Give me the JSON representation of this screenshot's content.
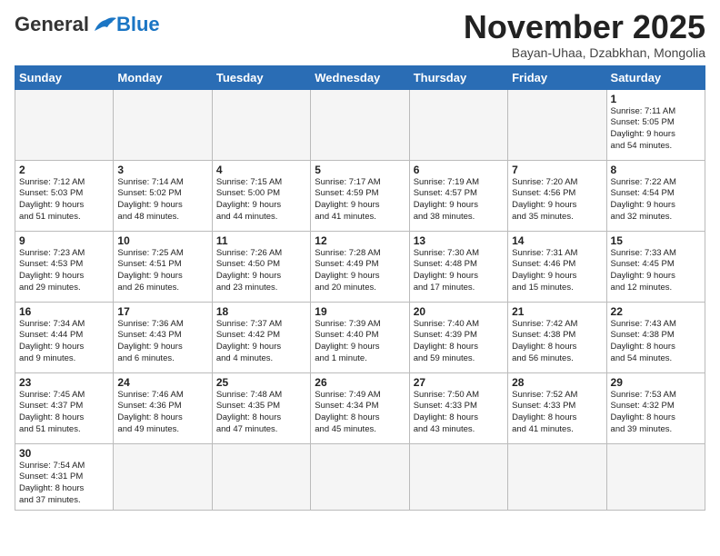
{
  "logo": {
    "general": "General",
    "blue": "Blue"
  },
  "title": "November 2025",
  "subtitle": "Bayan-Uhaa, Dzabkhan, Mongolia",
  "days_header": [
    "Sunday",
    "Monday",
    "Tuesday",
    "Wednesday",
    "Thursday",
    "Friday",
    "Saturday"
  ],
  "weeks": [
    [
      {
        "day": "",
        "info": "",
        "empty": true
      },
      {
        "day": "",
        "info": "",
        "empty": true
      },
      {
        "day": "",
        "info": "",
        "empty": true
      },
      {
        "day": "",
        "info": "",
        "empty": true
      },
      {
        "day": "",
        "info": "",
        "empty": true
      },
      {
        "day": "",
        "info": "",
        "empty": true
      },
      {
        "day": "1",
        "info": "Sunrise: 7:11 AM\nSunset: 5:05 PM\nDaylight: 9 hours\nand 54 minutes."
      }
    ],
    [
      {
        "day": "2",
        "info": "Sunrise: 7:12 AM\nSunset: 5:03 PM\nDaylight: 9 hours\nand 51 minutes."
      },
      {
        "day": "3",
        "info": "Sunrise: 7:14 AM\nSunset: 5:02 PM\nDaylight: 9 hours\nand 48 minutes."
      },
      {
        "day": "4",
        "info": "Sunrise: 7:15 AM\nSunset: 5:00 PM\nDaylight: 9 hours\nand 44 minutes."
      },
      {
        "day": "5",
        "info": "Sunrise: 7:17 AM\nSunset: 4:59 PM\nDaylight: 9 hours\nand 41 minutes."
      },
      {
        "day": "6",
        "info": "Sunrise: 7:19 AM\nSunset: 4:57 PM\nDaylight: 9 hours\nand 38 minutes."
      },
      {
        "day": "7",
        "info": "Sunrise: 7:20 AM\nSunset: 4:56 PM\nDaylight: 9 hours\nand 35 minutes."
      },
      {
        "day": "8",
        "info": "Sunrise: 7:22 AM\nSunset: 4:54 PM\nDaylight: 9 hours\nand 32 minutes."
      }
    ],
    [
      {
        "day": "9",
        "info": "Sunrise: 7:23 AM\nSunset: 4:53 PM\nDaylight: 9 hours\nand 29 minutes."
      },
      {
        "day": "10",
        "info": "Sunrise: 7:25 AM\nSunset: 4:51 PM\nDaylight: 9 hours\nand 26 minutes."
      },
      {
        "day": "11",
        "info": "Sunrise: 7:26 AM\nSunset: 4:50 PM\nDaylight: 9 hours\nand 23 minutes."
      },
      {
        "day": "12",
        "info": "Sunrise: 7:28 AM\nSunset: 4:49 PM\nDaylight: 9 hours\nand 20 minutes."
      },
      {
        "day": "13",
        "info": "Sunrise: 7:30 AM\nSunset: 4:48 PM\nDaylight: 9 hours\nand 17 minutes."
      },
      {
        "day": "14",
        "info": "Sunrise: 7:31 AM\nSunset: 4:46 PM\nDaylight: 9 hours\nand 15 minutes."
      },
      {
        "day": "15",
        "info": "Sunrise: 7:33 AM\nSunset: 4:45 PM\nDaylight: 9 hours\nand 12 minutes."
      }
    ],
    [
      {
        "day": "16",
        "info": "Sunrise: 7:34 AM\nSunset: 4:44 PM\nDaylight: 9 hours\nand 9 minutes."
      },
      {
        "day": "17",
        "info": "Sunrise: 7:36 AM\nSunset: 4:43 PM\nDaylight: 9 hours\nand 6 minutes."
      },
      {
        "day": "18",
        "info": "Sunrise: 7:37 AM\nSunset: 4:42 PM\nDaylight: 9 hours\nand 4 minutes."
      },
      {
        "day": "19",
        "info": "Sunrise: 7:39 AM\nSunset: 4:40 PM\nDaylight: 9 hours\nand 1 minute."
      },
      {
        "day": "20",
        "info": "Sunrise: 7:40 AM\nSunset: 4:39 PM\nDaylight: 8 hours\nand 59 minutes."
      },
      {
        "day": "21",
        "info": "Sunrise: 7:42 AM\nSunset: 4:38 PM\nDaylight: 8 hours\nand 56 minutes."
      },
      {
        "day": "22",
        "info": "Sunrise: 7:43 AM\nSunset: 4:38 PM\nDaylight: 8 hours\nand 54 minutes."
      }
    ],
    [
      {
        "day": "23",
        "info": "Sunrise: 7:45 AM\nSunset: 4:37 PM\nDaylight: 8 hours\nand 51 minutes."
      },
      {
        "day": "24",
        "info": "Sunrise: 7:46 AM\nSunset: 4:36 PM\nDaylight: 8 hours\nand 49 minutes."
      },
      {
        "day": "25",
        "info": "Sunrise: 7:48 AM\nSunset: 4:35 PM\nDaylight: 8 hours\nand 47 minutes."
      },
      {
        "day": "26",
        "info": "Sunrise: 7:49 AM\nSunset: 4:34 PM\nDaylight: 8 hours\nand 45 minutes."
      },
      {
        "day": "27",
        "info": "Sunrise: 7:50 AM\nSunset: 4:33 PM\nDaylight: 8 hours\nand 43 minutes."
      },
      {
        "day": "28",
        "info": "Sunrise: 7:52 AM\nSunset: 4:33 PM\nDaylight: 8 hours\nand 41 minutes."
      },
      {
        "day": "29",
        "info": "Sunrise: 7:53 AM\nSunset: 4:32 PM\nDaylight: 8 hours\nand 39 minutes."
      }
    ],
    [
      {
        "day": "30",
        "info": "Sunrise: 7:54 AM\nSunset: 4:31 PM\nDaylight: 8 hours\nand 37 minutes."
      },
      {
        "day": "",
        "info": "",
        "empty": true
      },
      {
        "day": "",
        "info": "",
        "empty": true
      },
      {
        "day": "",
        "info": "",
        "empty": true
      },
      {
        "day": "",
        "info": "",
        "empty": true
      },
      {
        "day": "",
        "info": "",
        "empty": true
      },
      {
        "day": "",
        "info": "",
        "empty": true
      }
    ]
  ]
}
